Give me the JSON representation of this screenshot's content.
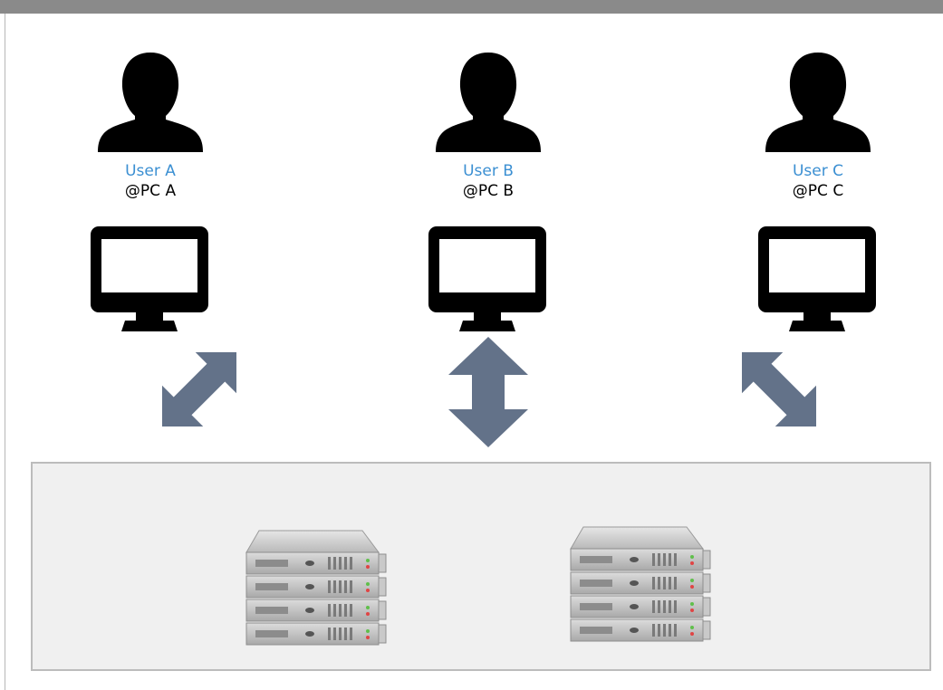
{
  "users": [
    {
      "name": "User A",
      "pc": "@PC A"
    },
    {
      "name": "User B",
      "pc": "@PC B"
    },
    {
      "name": "User C",
      "pc": "@PC C"
    }
  ],
  "colors": {
    "user_name": "#3b8fd2",
    "arrow": "#637289",
    "server_area": "#f0f0f0"
  }
}
